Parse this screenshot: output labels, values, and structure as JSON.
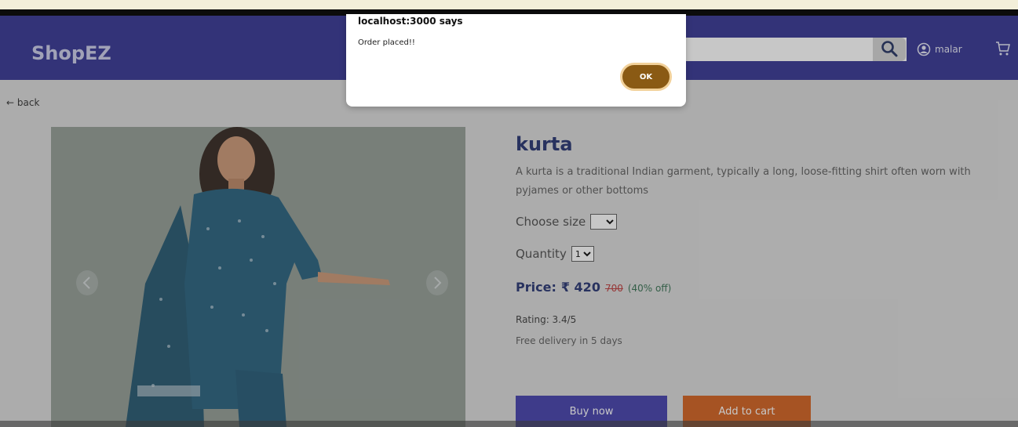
{
  "navbar": {
    "brand": "ShopEZ",
    "search_placeholder": "",
    "username": "malar"
  },
  "back_label": "← back",
  "product": {
    "title": "kurta",
    "description": "A kurta is a traditional Indian garment, typically a long, loose-fitting shirt often worn with pyjames or other bottoms",
    "size_label": "Choose size",
    "size_value": "",
    "quantity_label": "Quantity",
    "quantity_value": "1",
    "price_label": "Price:",
    "price": "₹ 420",
    "original_price": "700",
    "discount": "(40% off)",
    "rating": "Rating: 3.4/5",
    "delivery": "Free delivery in 5 days"
  },
  "buttons": {
    "buy_now": "Buy now",
    "add_to_cart": "Add to cart"
  },
  "dialog": {
    "title": "localhost:3000 says",
    "message": "Order placed!!",
    "ok": "OK"
  },
  "colors": {
    "navbar": "#2b2b8f",
    "buy_button": "#3b37a8",
    "cart_button": "#d05a15",
    "ok_button": "#8a5a14"
  },
  "icons": {
    "search": "search-icon",
    "user": "user-circle-icon",
    "cart": "cart-icon",
    "prev": "chevron-left-icon",
    "next": "chevron-right-icon"
  }
}
